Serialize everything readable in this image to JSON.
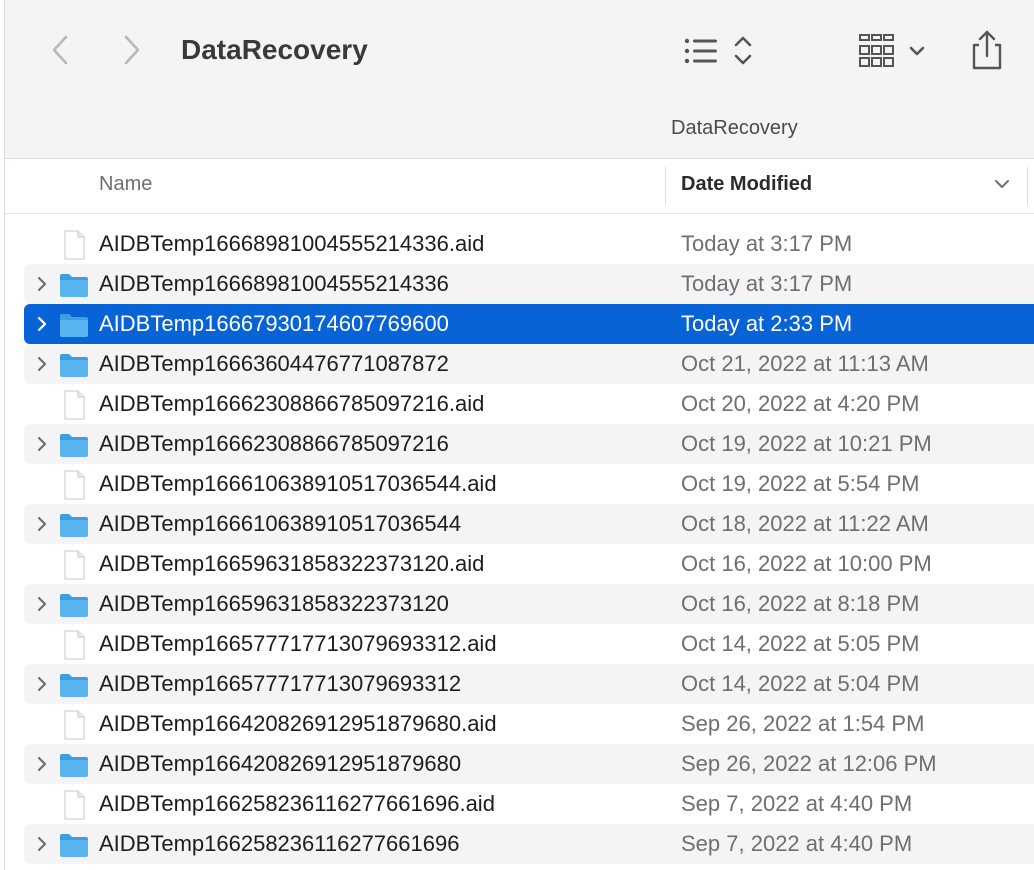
{
  "window": {
    "title": "DataRecovery",
    "path": "DataRecovery"
  },
  "toolbar": {
    "back_icon": "chevron-left-icon",
    "forward_icon": "chevron-right-icon",
    "view_icon": "list-view-icon",
    "group_icon": "group-grid-icon",
    "share_icon": "share-icon"
  },
  "columns": {
    "name": "Name",
    "date_modified": "Date Modified"
  },
  "colors": {
    "selection": "#0863d6",
    "folder": "#5ab4f0",
    "toolbar_bg": "#f6f3f6"
  },
  "files": [
    {
      "name": "AIDBTemp1666898100455521433​6.aid",
      "date": "Today at 3:17 PM",
      "kind": "file",
      "selected": false
    },
    {
      "name": "AIDBTemp16668981004555214336",
      "date": "Today at 3:17 PM",
      "kind": "folder",
      "selected": false
    },
    {
      "name": "AIDBTemp16667930174607769600",
      "date": "Today at 2:33 PM",
      "kind": "folder",
      "selected": true
    },
    {
      "name": "AIDBTemp16663604476771087872",
      "date": "Oct 21, 2022 at 11:13 AM",
      "kind": "folder",
      "selected": false
    },
    {
      "name": "AIDBTemp16662308866785097216.aid",
      "date": "Oct 20, 2022 at 4:20 PM",
      "kind": "file",
      "selected": false
    },
    {
      "name": "AIDBTemp16662308866785097216",
      "date": "Oct 19, 2022 at 10:21 PM",
      "kind": "folder",
      "selected": false
    },
    {
      "name": "AIDBTemp16661063891051703654​4.aid",
      "date": "Oct 19, 2022 at 5:54 PM",
      "kind": "file",
      "selected": false
    },
    {
      "name": "AIDBTemp16661063891051703654​4",
      "date": "Oct 18, 2022 at 11:22 AM",
      "kind": "folder",
      "selected": false
    },
    {
      "name": "AIDBTemp16659631858322373120.aid",
      "date": "Oct 16, 2022 at 10:00 PM",
      "kind": "file",
      "selected": false
    },
    {
      "name": "AIDBTemp16659631858322373120",
      "date": "Oct 16, 2022 at 8:18 PM",
      "kind": "folder",
      "selected": false
    },
    {
      "name": "AIDBTemp16657771771307969331​2.aid",
      "date": "Oct 14, 2022 at 5:05 PM",
      "kind": "file",
      "selected": false
    },
    {
      "name": "AIDBTemp16657771771307969331​2",
      "date": "Oct 14, 2022 at 5:04 PM",
      "kind": "folder",
      "selected": false
    },
    {
      "name": "AIDBTemp16642082691295187968​0.aid",
      "date": "Sep 26, 2022 at 1:54 PM",
      "kind": "file",
      "selected": false
    },
    {
      "name": "AIDBTemp16642082691295187968​0",
      "date": "Sep 26, 2022 at 12:06 PM",
      "kind": "folder",
      "selected": false
    },
    {
      "name": "AIDBTemp16625823611627766169​6.aid",
      "date": "Sep 7, 2022 at 4:40 PM",
      "kind": "file",
      "selected": false
    },
    {
      "name": "AIDBTemp16625823611627766169​6",
      "date": "Sep 7, 2022 at 4:40 PM",
      "kind": "folder",
      "selected": false
    }
  ]
}
